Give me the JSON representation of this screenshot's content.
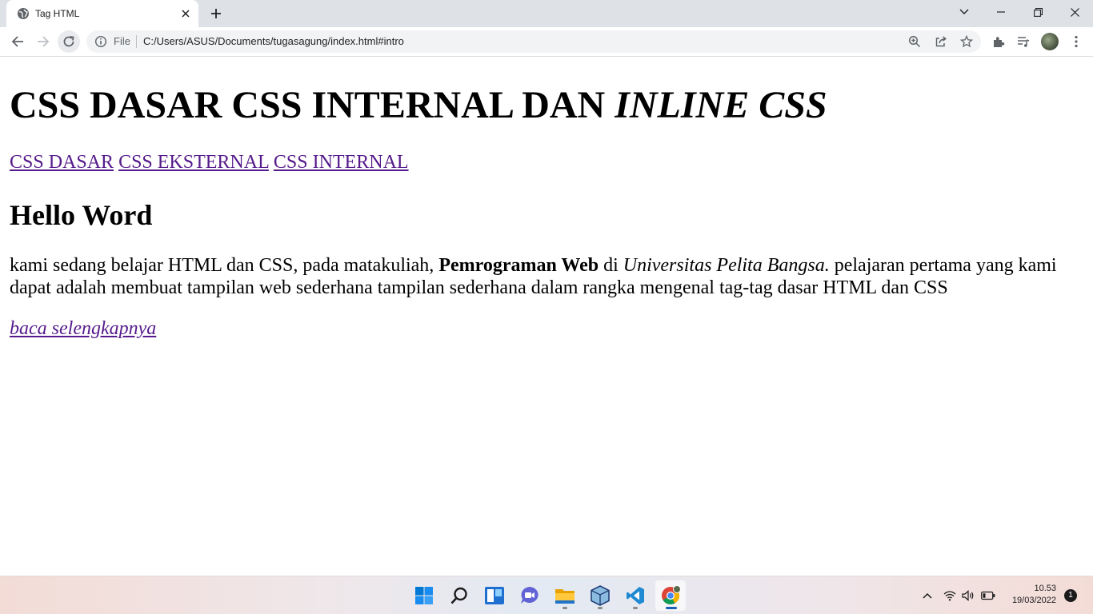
{
  "browser": {
    "tab": {
      "title": "Tag HTML",
      "favicon": "globe-icon"
    },
    "address_bar": {
      "scheme_label": "File",
      "url": "C:/Users/ASUS/Documents/tugasagung/index.html#intro"
    }
  },
  "page": {
    "heading_main": "CSS DASAR CSS INTERNAL DAN ",
    "heading_emphasis": "INLINE CSS",
    "nav_links": [
      "CSS DASAR",
      "CSS EKSTERNAL",
      "CSS INTERNAL"
    ],
    "subheading": "Hello Word",
    "paragraph": {
      "part1": "kami sedang belajar HTML dan CSS, pada matakuliah, ",
      "bold": "Pemrograman Web",
      "part2": " di ",
      "italic": "Universitas Pelita Bangsa.",
      "part3": " pelajaran pertama yang kami dapat adalah membuat tampilan web sederhana tampilan sederhana dalam rangka mengenal tag-tag dasar HTML dan CSS"
    },
    "read_more": "baca selengkapnya"
  },
  "taskbar": {
    "apps": [
      "windows-start-icon",
      "search-icon",
      "widgets-icon",
      "teams-chat-icon",
      "file-explorer-icon",
      "virtualbox-icon",
      "vscode-icon",
      "chrome-icon"
    ],
    "time": "10.53",
    "date": "19/03/2022",
    "notification_count": "1"
  }
}
